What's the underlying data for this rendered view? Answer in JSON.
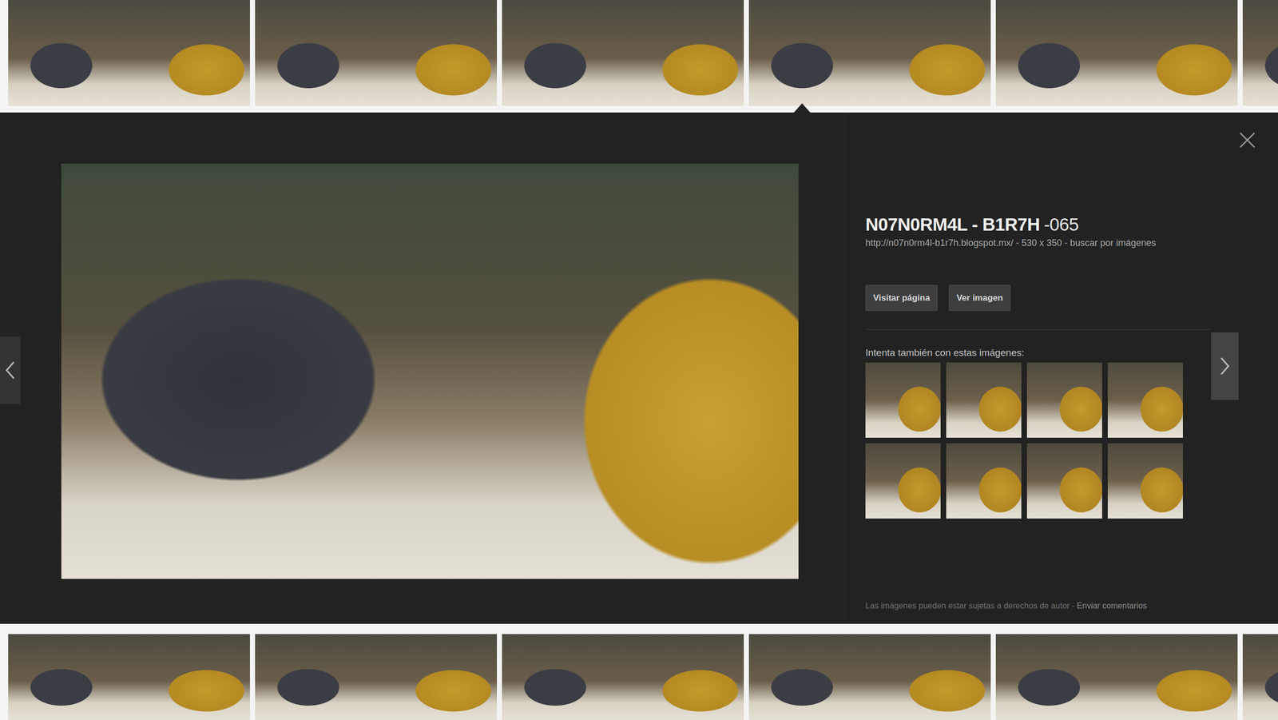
{
  "results_top": [
    {
      "selected": false
    },
    {
      "selected": false
    },
    {
      "selected": false
    },
    {
      "selected": true
    },
    {
      "selected": false
    },
    {
      "selected": false
    }
  ],
  "preview": {
    "title": "N07N0RM4L - B1R7H",
    "suffix": "-065",
    "url": "http://n07n0rm4l-b1r7h.blogspot.mx/",
    "separator": " - ",
    "size": "530 x 350",
    "search_by_image": "buscar por imágenes",
    "buttons": [
      "Visitar página",
      "Ver imagen"
    ],
    "related_label": "Intenta también con estas imágenes:",
    "related": [
      {
        "selected": false
      },
      {
        "selected": false
      },
      {
        "selected": false
      },
      {
        "selected": false
      },
      {
        "selected": false
      },
      {
        "selected": false
      },
      {
        "selected": false
      },
      {
        "selected": false
      }
    ],
    "footer": {
      "copyright": "Las imágenes pueden estar sujetas a derechos de autor",
      "separator": " - ",
      "feedback": "Enviar comentarios"
    }
  },
  "results_bottom": [
    {
      "selected": false
    },
    {
      "selected": false
    },
    {
      "selected": false
    },
    {
      "selected": false
    },
    {
      "selected": false
    },
    {
      "selected": false
    }
  ]
}
